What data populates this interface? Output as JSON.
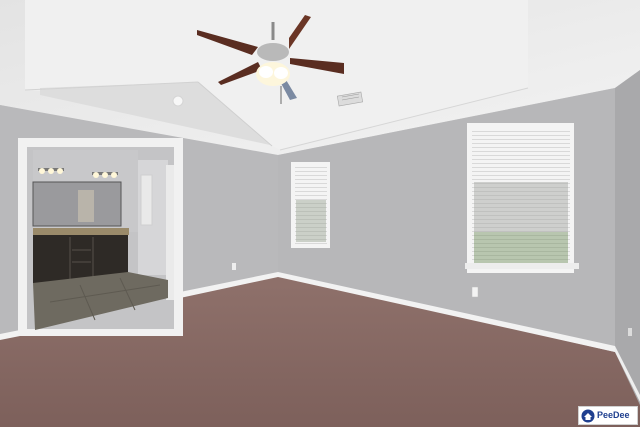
{
  "watermark": {
    "text": "PeeDee"
  },
  "colors": {
    "wall": "#b9b9bb",
    "wall_shadow": "#a9a9ab",
    "ceiling": "#ebebeb",
    "carpet": "#8a6b66",
    "trim": "#f2f2f2",
    "cabinet": "#2e2a26",
    "brand": "#1f3f8f"
  },
  "icons": {
    "ceiling_fan": "ceiling-fan-icon",
    "watermark_logo": "house-logo-icon"
  }
}
